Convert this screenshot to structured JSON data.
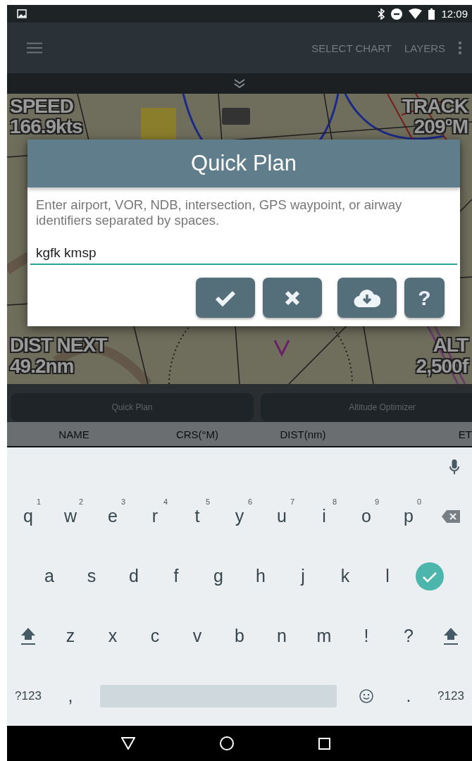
{
  "status_bar": {
    "time": "12:09"
  },
  "toolbar": {
    "actions": [
      "SELECT CHART",
      "LAYERS"
    ]
  },
  "map_overlay": {
    "speed_label": "SPEED",
    "speed_value": "166.9kts",
    "track_label": "TRACK",
    "track_value": "209°M",
    "dist_label": "DIST NEXT",
    "dist_value": "49.2nm",
    "alt_label": "ALT",
    "alt_value": "2,500f"
  },
  "dialog": {
    "title": "Quick Plan",
    "message": "Enter airport, VOR, NDB, intersection, GPS waypoint, or airway identifiers separated by spaces.",
    "input_value": "kgfk kmsp",
    "buttons": [
      {
        "kind": "confirm"
      },
      {
        "kind": "cancel"
      },
      {
        "kind": "download"
      },
      {
        "kind": "help",
        "label": "?"
      }
    ]
  },
  "plan_panel": {
    "buttons": [
      "Quick Plan",
      "Altitude Optimizer"
    ],
    "columns": [
      "NAME",
      "CRS(°M)",
      "DIST(nm)",
      "ET"
    ]
  },
  "keyboard": {
    "rows": [
      {
        "keys": [
          {
            "kind": "letter",
            "label": "q",
            "hint": "1"
          },
          {
            "kind": "letter",
            "label": "w",
            "hint": "2"
          },
          {
            "kind": "letter",
            "label": "e",
            "hint": "3"
          },
          {
            "kind": "letter",
            "label": "r",
            "hint": "4"
          },
          {
            "kind": "letter",
            "label": "t",
            "hint": "5"
          },
          {
            "kind": "letter",
            "label": "y",
            "hint": "6"
          },
          {
            "kind": "letter",
            "label": "u",
            "hint": "7"
          },
          {
            "kind": "letter",
            "label": "i",
            "hint": "8"
          },
          {
            "kind": "letter",
            "label": "o",
            "hint": "9"
          },
          {
            "kind": "letter",
            "label": "p",
            "hint": "0"
          },
          {
            "kind": "backspace"
          }
        ]
      },
      {
        "keys": [
          {
            "kind": "letter",
            "label": "a"
          },
          {
            "kind": "letter",
            "label": "s"
          },
          {
            "kind": "letter",
            "label": "d"
          },
          {
            "kind": "letter",
            "label": "f"
          },
          {
            "kind": "letter",
            "label": "g"
          },
          {
            "kind": "letter",
            "label": "h"
          },
          {
            "kind": "letter",
            "label": "j"
          },
          {
            "kind": "letter",
            "label": "k"
          },
          {
            "kind": "letter",
            "label": "l"
          },
          {
            "kind": "enter"
          }
        ]
      },
      {
        "keys": [
          {
            "kind": "shift"
          },
          {
            "kind": "letter",
            "label": "z"
          },
          {
            "kind": "letter",
            "label": "x"
          },
          {
            "kind": "letter",
            "label": "c"
          },
          {
            "kind": "letter",
            "label": "v"
          },
          {
            "kind": "letter",
            "label": "b"
          },
          {
            "kind": "letter",
            "label": "n"
          },
          {
            "kind": "letter",
            "label": "m"
          },
          {
            "kind": "letter",
            "label": "!"
          },
          {
            "kind": "letter",
            "label": "?"
          },
          {
            "kind": "shift"
          }
        ]
      },
      {
        "keys": [
          {
            "kind": "text",
            "label": "?123"
          },
          {
            "kind": "letter",
            "label": ","
          },
          {
            "kind": "space"
          },
          {
            "kind": "emoji"
          },
          {
            "kind": "letter",
            "label": "."
          },
          {
            "kind": "text",
            "label": "?123"
          }
        ]
      }
    ]
  }
}
